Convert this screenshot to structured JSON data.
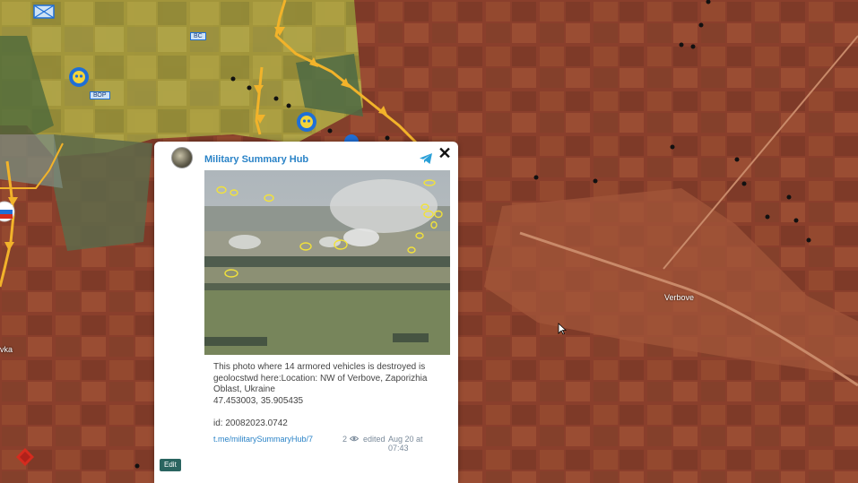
{
  "map": {
    "town_labels": {
      "verbove": "Verbove",
      "partial_left": "vka"
    },
    "markers": {
      "unit_label_1": "BC",
      "unit_label_2": "ВОР"
    },
    "colors": {
      "occupied": "#b0432a",
      "contested": "#c9b83a",
      "front_line": "#f2b32a",
      "marker_blue": "#1f6fd6"
    }
  },
  "popup": {
    "close_label": "✕",
    "channel_name": "Military Summary Hub",
    "post_text": "This photo where 14 armored vehicles is destroyed is geolocstwd here:Location: NW of Verbove, Zaporizhia Oblast, Ukraine\n47.453003, 35.905435\n\nid: 20082023.0742",
    "link": "t.me/militarySummaryHub/7",
    "views": "2",
    "edited": "edited",
    "date": "Aug 20 at 07:43",
    "edit_button": "Edit",
    "icons": [
      "telegram-icon",
      "eye-icon",
      "close-icon"
    ]
  }
}
